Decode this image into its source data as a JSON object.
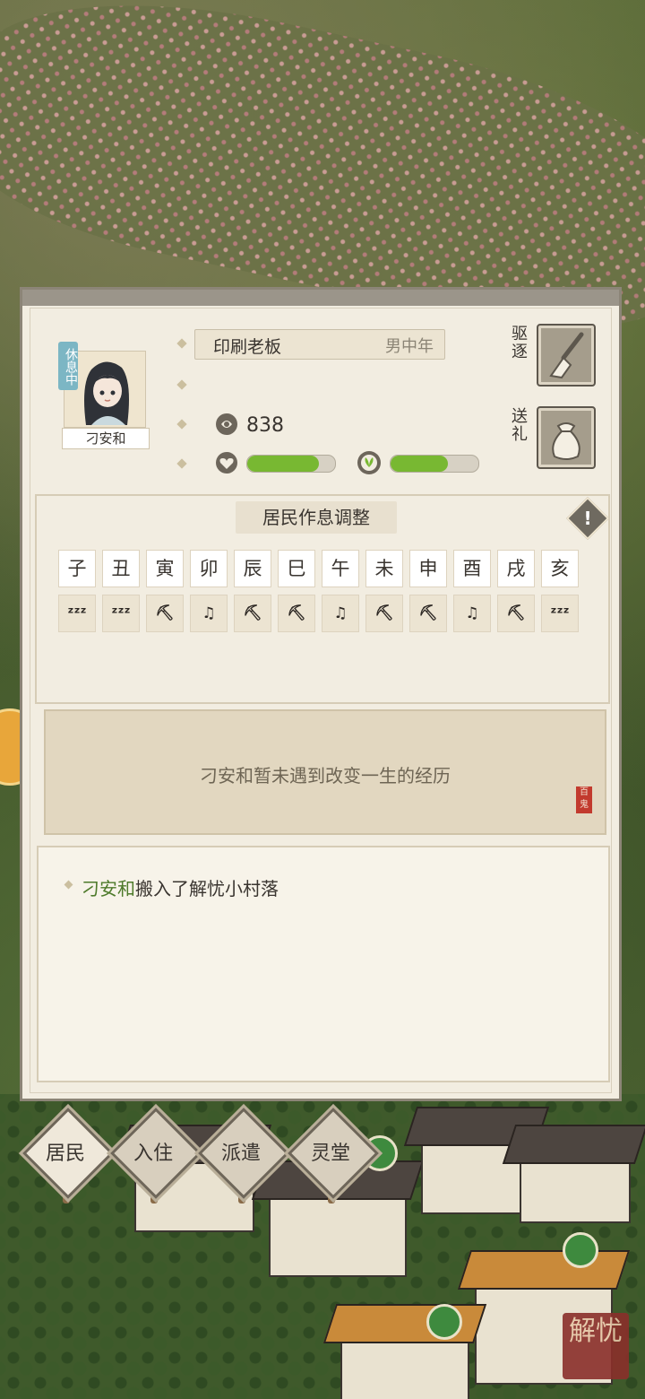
{
  "resident": {
    "status_tag": "休息中",
    "name": "刁安和",
    "job": "印刷老板",
    "age_group": "男中年",
    "coins": "838",
    "health_pct": 82,
    "mood_pct": 65
  },
  "actions": {
    "evict_label": "驱逐",
    "gift_label": "送礼"
  },
  "schedule": {
    "title": "居民作息调整",
    "hours": [
      "子",
      "丑",
      "寅",
      "卯",
      "辰",
      "巳",
      "午",
      "未",
      "申",
      "酉",
      "戌",
      "亥"
    ],
    "activities": [
      {
        "icon": "sleep-icon",
        "glyph": "ᶻᶻᶻ"
      },
      {
        "icon": "sleep-icon",
        "glyph": "ᶻᶻᶻ"
      },
      {
        "icon": "work-icon",
        "glyph": "⛏"
      },
      {
        "icon": "leisure-icon",
        "glyph": "♫"
      },
      {
        "icon": "work-icon",
        "glyph": "⛏"
      },
      {
        "icon": "work-icon",
        "glyph": "⛏"
      },
      {
        "icon": "leisure-icon",
        "glyph": "♫"
      },
      {
        "icon": "work-icon",
        "glyph": "⛏"
      },
      {
        "icon": "work-icon",
        "glyph": "⛏"
      },
      {
        "icon": "leisure-icon",
        "glyph": "♫"
      },
      {
        "icon": "work-icon",
        "glyph": "⛏"
      },
      {
        "icon": "sleep-icon",
        "glyph": "ᶻᶻᶻ"
      }
    ]
  },
  "experience": {
    "text": "刁安和暂未遇到改变一生的经历",
    "stamp": "百鬼"
  },
  "log": {
    "entries": [
      {
        "name": "刁安和",
        "text": "搬入了解忧小村落"
      }
    ]
  },
  "tabs": [
    "居民",
    "入住",
    "派遣",
    "灵堂"
  ],
  "seal_text": "解忧",
  "colors": {
    "bar_fill": "#78b832",
    "log_name": "#4d7a2a",
    "rest_tag": "#7cb6c4"
  }
}
